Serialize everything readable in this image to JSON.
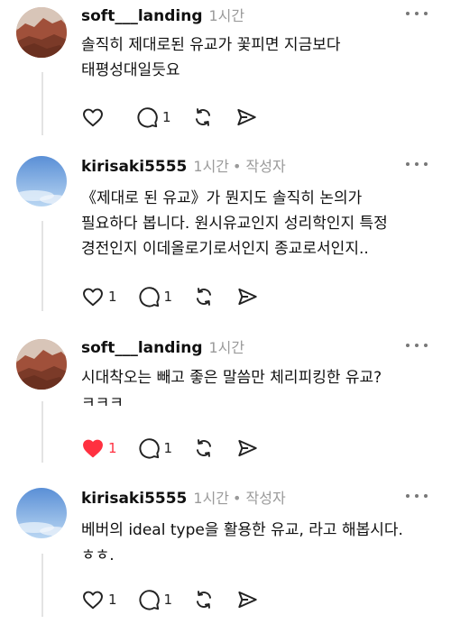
{
  "comments": [
    {
      "username": "soft___landing",
      "time": "1시간",
      "author_tag": "",
      "avatar": "landscape-avatar",
      "lines": [
        "솔직히 제대로된 유교가 꽃피면 지금보다",
        "태평성대일듯요"
      ],
      "likes": "",
      "liked": false,
      "replies": "1"
    },
    {
      "username": "kirisaki5555",
      "time": "1시간",
      "author_tag": "• 작성자",
      "avatar": "sky-avatar",
      "lines": [
        "《제대로 된 유교》가 뭔지도 솔직히 논의가",
        "필요하다 봅니다. 원시유교인지 성리학인지 특정",
        "경전인지 이데올로기로서인지 종교로서인지.."
      ],
      "likes": "1",
      "liked": false,
      "replies": "1"
    },
    {
      "username": "soft___landing",
      "time": "1시간",
      "author_tag": "",
      "avatar": "landscape-avatar",
      "lines": [
        "시대착오는 빼고 좋은 말씀만 체리피킹한 유교?",
        "ㅋㅋㅋ"
      ],
      "likes": "1",
      "liked": true,
      "replies": "1"
    },
    {
      "username": "kirisaki5555",
      "time": "1시간",
      "author_tag": "• 작성자",
      "avatar": "sky-avatar",
      "lines": [
        "베버의 ideal type을 활용한 유교, 라고 해봅시다.",
        "ㅎㅎ."
      ],
      "likes": "1",
      "liked": false,
      "replies": "1"
    }
  ],
  "colors": {
    "like_active": "#ff3040",
    "meta": "#9a9a9a",
    "icon": "#222222"
  }
}
